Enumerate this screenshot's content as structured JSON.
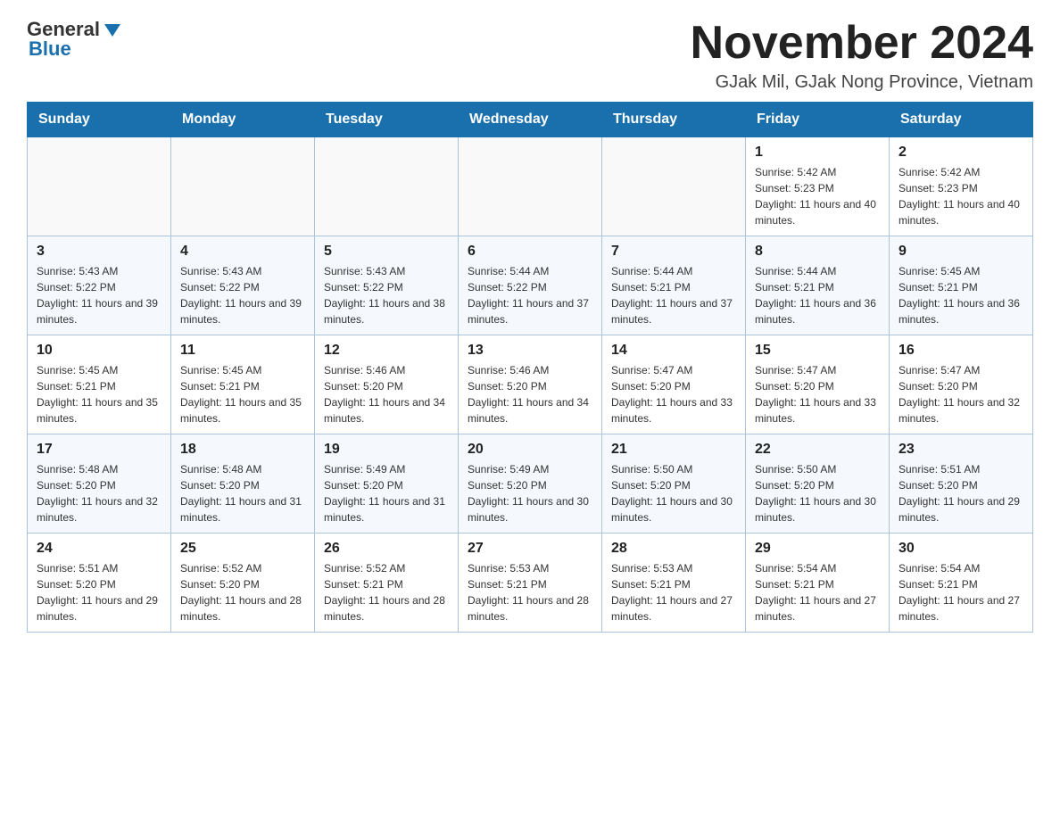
{
  "header": {
    "logo_general": "General",
    "logo_blue": "Blue",
    "month_title": "November 2024",
    "location": "GJak Mil, GJak Nong Province, Vietnam"
  },
  "weekdays": [
    "Sunday",
    "Monday",
    "Tuesday",
    "Wednesday",
    "Thursday",
    "Friday",
    "Saturday"
  ],
  "weeks": [
    [
      {
        "day": "",
        "info": ""
      },
      {
        "day": "",
        "info": ""
      },
      {
        "day": "",
        "info": ""
      },
      {
        "day": "",
        "info": ""
      },
      {
        "day": "",
        "info": ""
      },
      {
        "day": "1",
        "info": "Sunrise: 5:42 AM\nSunset: 5:23 PM\nDaylight: 11 hours and 40 minutes."
      },
      {
        "day": "2",
        "info": "Sunrise: 5:42 AM\nSunset: 5:23 PM\nDaylight: 11 hours and 40 minutes."
      }
    ],
    [
      {
        "day": "3",
        "info": "Sunrise: 5:43 AM\nSunset: 5:22 PM\nDaylight: 11 hours and 39 minutes."
      },
      {
        "day": "4",
        "info": "Sunrise: 5:43 AM\nSunset: 5:22 PM\nDaylight: 11 hours and 39 minutes."
      },
      {
        "day": "5",
        "info": "Sunrise: 5:43 AM\nSunset: 5:22 PM\nDaylight: 11 hours and 38 minutes."
      },
      {
        "day": "6",
        "info": "Sunrise: 5:44 AM\nSunset: 5:22 PM\nDaylight: 11 hours and 37 minutes."
      },
      {
        "day": "7",
        "info": "Sunrise: 5:44 AM\nSunset: 5:21 PM\nDaylight: 11 hours and 37 minutes."
      },
      {
        "day": "8",
        "info": "Sunrise: 5:44 AM\nSunset: 5:21 PM\nDaylight: 11 hours and 36 minutes."
      },
      {
        "day": "9",
        "info": "Sunrise: 5:45 AM\nSunset: 5:21 PM\nDaylight: 11 hours and 36 minutes."
      }
    ],
    [
      {
        "day": "10",
        "info": "Sunrise: 5:45 AM\nSunset: 5:21 PM\nDaylight: 11 hours and 35 minutes."
      },
      {
        "day": "11",
        "info": "Sunrise: 5:45 AM\nSunset: 5:21 PM\nDaylight: 11 hours and 35 minutes."
      },
      {
        "day": "12",
        "info": "Sunrise: 5:46 AM\nSunset: 5:20 PM\nDaylight: 11 hours and 34 minutes."
      },
      {
        "day": "13",
        "info": "Sunrise: 5:46 AM\nSunset: 5:20 PM\nDaylight: 11 hours and 34 minutes."
      },
      {
        "day": "14",
        "info": "Sunrise: 5:47 AM\nSunset: 5:20 PM\nDaylight: 11 hours and 33 minutes."
      },
      {
        "day": "15",
        "info": "Sunrise: 5:47 AM\nSunset: 5:20 PM\nDaylight: 11 hours and 33 minutes."
      },
      {
        "day": "16",
        "info": "Sunrise: 5:47 AM\nSunset: 5:20 PM\nDaylight: 11 hours and 32 minutes."
      }
    ],
    [
      {
        "day": "17",
        "info": "Sunrise: 5:48 AM\nSunset: 5:20 PM\nDaylight: 11 hours and 32 minutes."
      },
      {
        "day": "18",
        "info": "Sunrise: 5:48 AM\nSunset: 5:20 PM\nDaylight: 11 hours and 31 minutes."
      },
      {
        "day": "19",
        "info": "Sunrise: 5:49 AM\nSunset: 5:20 PM\nDaylight: 11 hours and 31 minutes."
      },
      {
        "day": "20",
        "info": "Sunrise: 5:49 AM\nSunset: 5:20 PM\nDaylight: 11 hours and 30 minutes."
      },
      {
        "day": "21",
        "info": "Sunrise: 5:50 AM\nSunset: 5:20 PM\nDaylight: 11 hours and 30 minutes."
      },
      {
        "day": "22",
        "info": "Sunrise: 5:50 AM\nSunset: 5:20 PM\nDaylight: 11 hours and 30 minutes."
      },
      {
        "day": "23",
        "info": "Sunrise: 5:51 AM\nSunset: 5:20 PM\nDaylight: 11 hours and 29 minutes."
      }
    ],
    [
      {
        "day": "24",
        "info": "Sunrise: 5:51 AM\nSunset: 5:20 PM\nDaylight: 11 hours and 29 minutes."
      },
      {
        "day": "25",
        "info": "Sunrise: 5:52 AM\nSunset: 5:20 PM\nDaylight: 11 hours and 28 minutes."
      },
      {
        "day": "26",
        "info": "Sunrise: 5:52 AM\nSunset: 5:21 PM\nDaylight: 11 hours and 28 minutes."
      },
      {
        "day": "27",
        "info": "Sunrise: 5:53 AM\nSunset: 5:21 PM\nDaylight: 11 hours and 28 minutes."
      },
      {
        "day": "28",
        "info": "Sunrise: 5:53 AM\nSunset: 5:21 PM\nDaylight: 11 hours and 27 minutes."
      },
      {
        "day": "29",
        "info": "Sunrise: 5:54 AM\nSunset: 5:21 PM\nDaylight: 11 hours and 27 minutes."
      },
      {
        "day": "30",
        "info": "Sunrise: 5:54 AM\nSunset: 5:21 PM\nDaylight: 11 hours and 27 minutes."
      }
    ]
  ]
}
